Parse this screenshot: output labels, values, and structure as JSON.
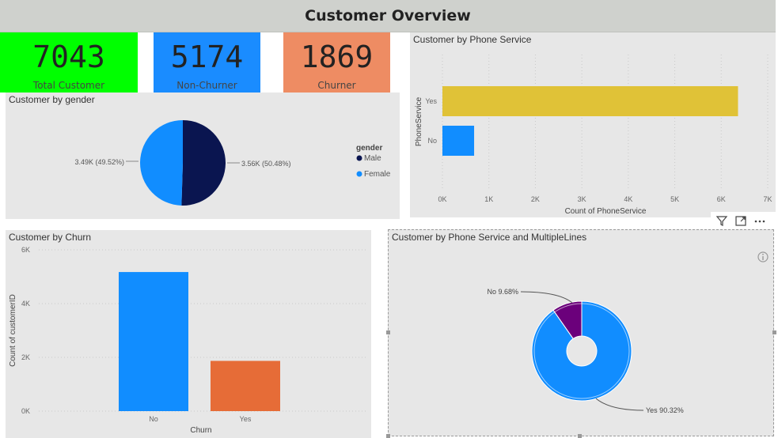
{
  "dashboard": {
    "title": "Customer Overview"
  },
  "cards": [
    {
      "value": "7043",
      "label": "Total Customer",
      "color": "#00ff00"
    },
    {
      "value": "5174",
      "label": "Non-Churner",
      "color": "#1a8cff"
    },
    {
      "value": "1869",
      "label": "Churner",
      "color": "#ee8c63"
    }
  ],
  "colors": {
    "blue": "#118dff",
    "navy": "#0a1550",
    "yellow": "#e0c237",
    "orange": "#e66c37",
    "purple": "#6b007b",
    "panel_bg": "#e7e7e7"
  },
  "chart_data": [
    {
      "type": "pie",
      "title": "Customer by gender",
      "legend_title": "gender",
      "legend_position": "right",
      "slices": [
        {
          "name": "Male",
          "value": 3.56,
          "label": "3.56K (50.48%)"
        },
        {
          "name": "Female",
          "value": 3.49,
          "label": "3.49K (49.52%)"
        }
      ]
    },
    {
      "type": "bar",
      "orientation": "horizontal",
      "title": "Customer by Phone Service",
      "xlabel": "Count of PhoneService",
      "ylabel": "PhoneService",
      "categories": [
        "Yes",
        "No"
      ],
      "values": [
        6361,
        682
      ],
      "xlim": [
        0,
        7000
      ],
      "ticks": [
        "0K",
        "1K",
        "2K",
        "3K",
        "4K",
        "5K",
        "6K",
        "7K"
      ],
      "grid": true
    },
    {
      "type": "bar",
      "title": "Customer by Churn",
      "xlabel": "Churn",
      "ylabel": "Count of customerID",
      "categories": [
        "No",
        "Yes"
      ],
      "values": [
        5174,
        1869
      ],
      "ylim": [
        0,
        6000
      ],
      "ticks": [
        "0K",
        "2K",
        "4K",
        "6K"
      ],
      "grid": true
    },
    {
      "type": "pie",
      "title": "Customer by Phone Service and MultipleLines",
      "slices": [
        {
          "name": "No",
          "value": 9.68,
          "label": "No 9.68%"
        },
        {
          "name": "Yes",
          "value": 90.32,
          "label": "Yes 90.32%"
        }
      ]
    }
  ]
}
